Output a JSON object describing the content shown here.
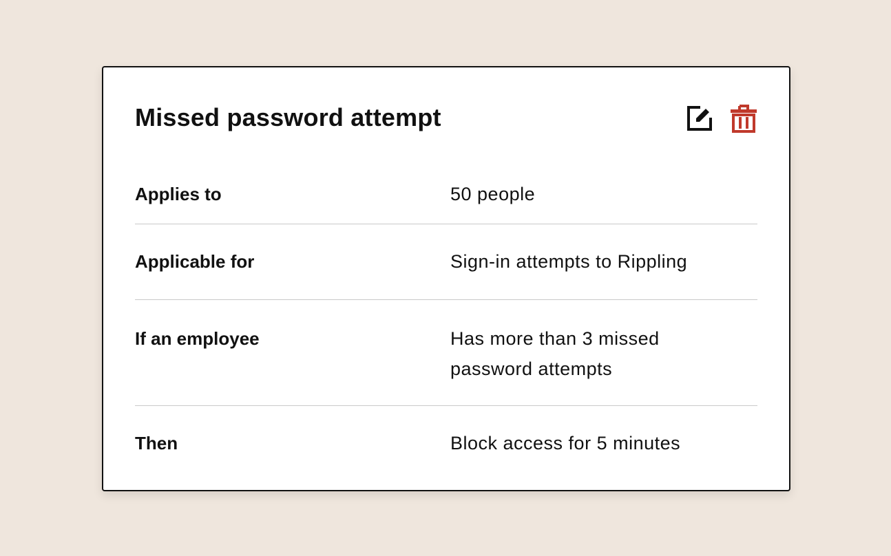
{
  "card": {
    "title": "Missed password attempt",
    "edit_icon": "edit-icon",
    "delete_icon": "trash-icon",
    "accent_color": "#c0392b",
    "rows": [
      {
        "label": "Applies to",
        "value": "50 people"
      },
      {
        "label": "Applicable for",
        "value": "Sign-in attempts to Rippling"
      },
      {
        "label": "If an employee",
        "value": "Has more than 3 missed password attempts"
      },
      {
        "label": "Then",
        "value": "Block access for 5 minutes"
      }
    ]
  }
}
